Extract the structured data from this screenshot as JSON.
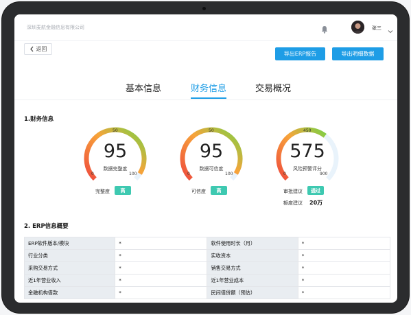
{
  "header": {
    "company": "深圳麦航金融信息有限公司",
    "username": "张三"
  },
  "toolbar": {
    "back_label": "返回",
    "export_erp_label": "导出ERP报告",
    "export_detail_label": "导出明细数据"
  },
  "tabs": [
    {
      "label": "基本信息",
      "active": false
    },
    {
      "label": "财务信息",
      "active": true
    },
    {
      "label": "交易概况",
      "active": false
    }
  ],
  "finance": {
    "title": "1.财务信息",
    "gauges": [
      {
        "value": "95",
        "caption": "数据完整度",
        "min": "0",
        "mid": "50",
        "max": "100",
        "fraction": 0.95,
        "label": "完整度",
        "badge": "高"
      },
      {
        "value": "95",
        "caption": "数据可信度",
        "min": "0",
        "mid": "50",
        "max": "100",
        "fraction": 0.95,
        "label": "可信度",
        "badge": "高"
      },
      {
        "value": "575",
        "caption": "风险预警评分",
        "min": "0",
        "mid": "450",
        "max": "900",
        "fraction": 0.64,
        "label": "审批建议",
        "badge": "通过"
      }
    ],
    "quota_label": "额度建议",
    "quota_value": "20万"
  },
  "erp": {
    "title": "2. ERP信息概要",
    "rows": [
      [
        "ERP软件版本/模块",
        "*",
        "软件使用时长（月）",
        "*"
      ],
      [
        "行业分类",
        "*",
        "实收资本",
        "*"
      ],
      [
        "采购交易方式",
        "*",
        "销售交易方式",
        "*"
      ],
      [
        "近1年营业收入",
        "*",
        "近1年营业成本",
        "*"
      ],
      [
        "金融机构借款",
        "*",
        "民间借贷额（预估）",
        "*"
      ]
    ]
  },
  "colors": {
    "accent": "#1e9de6",
    "badge": "#3ec9b1",
    "gauge_red": "#ef4b3c",
    "gauge_orange": "#f7a43a",
    "gauge_green": "#7bd045",
    "gauge_track": "#e9f3fb"
  }
}
